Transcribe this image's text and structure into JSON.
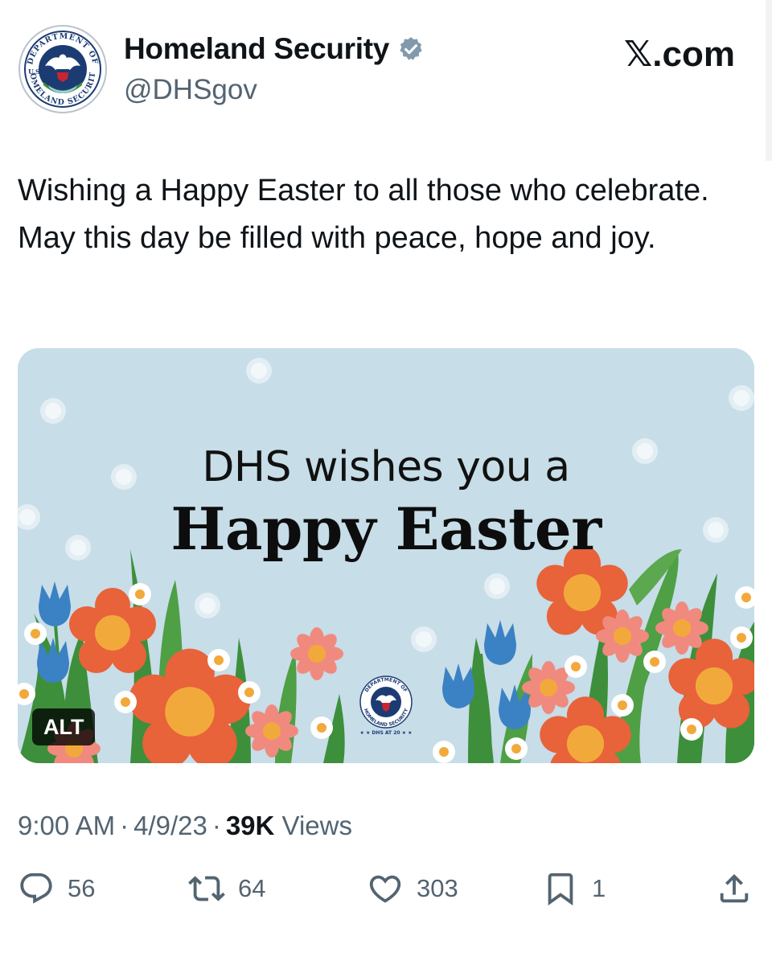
{
  "account": {
    "display_name": "Homeland Security",
    "handle": "@DHSgov",
    "avatar_icon": "dhs-seal-icon",
    "avatar_text_top": "DEPARTMENT OF",
    "avatar_text_left": "U.S.",
    "avatar_text_bottom": "HOMELAND SECURITY",
    "verified_icon": "verified-badge-icon",
    "verified_color": "#829aab"
  },
  "source": "𝕏.com",
  "tweet": {
    "text": "Wishing a Happy Easter to all those who celebrate. May this day be filled with peace, hope and joy."
  },
  "media": {
    "line1": "DHS wishes you a",
    "line2": "Happy Easter",
    "alt_label": "ALT",
    "seal_text_top": "DEPARTMENT OF",
    "seal_text_bottom": "HOMELAND SECURITY",
    "seal_caption": "★ ★ DHS AT 20 ★ ★",
    "colors": {
      "sky": "#c7dde8",
      "orange_flower": "#e8623a",
      "flower_center": "#f2a93b",
      "pink_flower": "#f08a7e",
      "blue_tulip": "#3b82c4",
      "leaf": "#3d8f3b"
    }
  },
  "meta": {
    "time": "9:00 AM",
    "separator": "·",
    "date": "4/9/23",
    "views_count": "39K",
    "views_label": "Views"
  },
  "actions": {
    "replies": {
      "icon": "reply-icon",
      "count": "56"
    },
    "reposts": {
      "icon": "repost-icon",
      "count": "64"
    },
    "likes": {
      "icon": "heart-icon",
      "count": "303"
    },
    "bookmarks": {
      "icon": "bookmark-icon",
      "count": "1"
    },
    "share": {
      "icon": "share-icon"
    }
  }
}
